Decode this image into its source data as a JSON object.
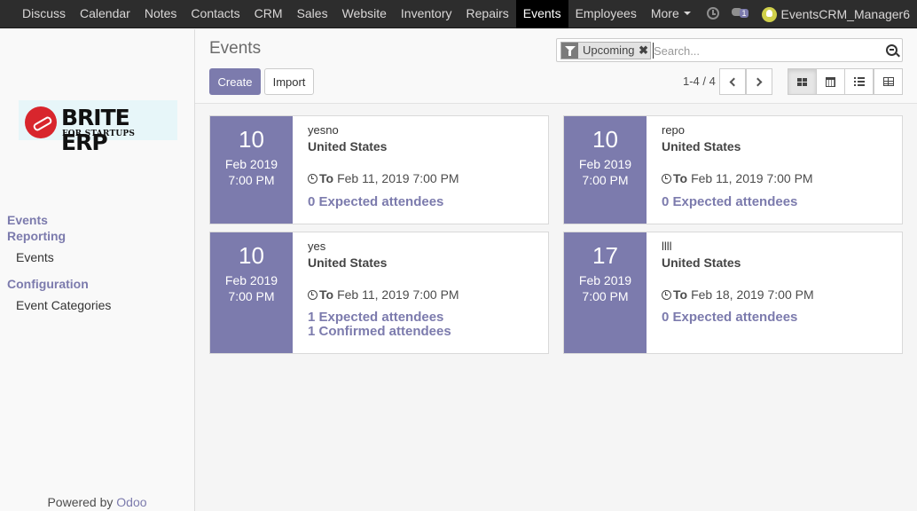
{
  "topnav": {
    "items": [
      "Discuss",
      "Calendar",
      "Notes",
      "Contacts",
      "CRM",
      "Sales",
      "Website",
      "Inventory",
      "Repairs",
      "Events",
      "Employees",
      "More"
    ],
    "active": "Events",
    "chat_count": "1",
    "user": "EventsCRM_Manager6"
  },
  "sidebar": {
    "logo_brand": "BRITE ERP",
    "logo_tag": "FOR STARTUPS",
    "section_events": "Events",
    "section_reporting": "Reporting",
    "reporting_events": "Events",
    "section_configuration": "Configuration",
    "config_event_categories": "Event Categories",
    "powered_by": "Powered by",
    "powered_brand": "Odoo"
  },
  "control": {
    "title": "Events",
    "create": "Create",
    "import": "Import",
    "filter_facet": "Upcoming",
    "search_placeholder": "Search...",
    "pager": "1-4 / 4"
  },
  "cards": [
    {
      "day": "10",
      "month": "Feb 2019",
      "time": "7:00 PM",
      "name": "yesno",
      "country": "United States",
      "to_label": "To",
      "to_date": "Feb 11, 2019 7:00 PM",
      "attendees": [
        "0 Expected attendees"
      ]
    },
    {
      "day": "10",
      "month": "Feb 2019",
      "time": "7:00 PM",
      "name": "repo",
      "country": "United States",
      "to_label": "To",
      "to_date": "Feb 11, 2019 7:00 PM",
      "attendees": [
        "0 Expected attendees"
      ]
    },
    {
      "day": "10",
      "month": "Feb 2019",
      "time": "7:00 PM",
      "name": "yes",
      "country": "United States",
      "to_label": "To",
      "to_date": "Feb 11, 2019 7:00 PM",
      "attendees": [
        "1 Expected attendees",
        "1 Confirmed attendees"
      ]
    },
    {
      "day": "17",
      "month": "Feb 2019",
      "time": "7:00 PM",
      "name": "llll",
      "country": "United States",
      "to_label": "To",
      "to_date": "Feb 18, 2019 7:00 PM",
      "attendees": [
        "0 Expected attendees"
      ]
    }
  ],
  "colors": {
    "brand": "#7c7bad",
    "topbar": "#2d2d2d"
  }
}
